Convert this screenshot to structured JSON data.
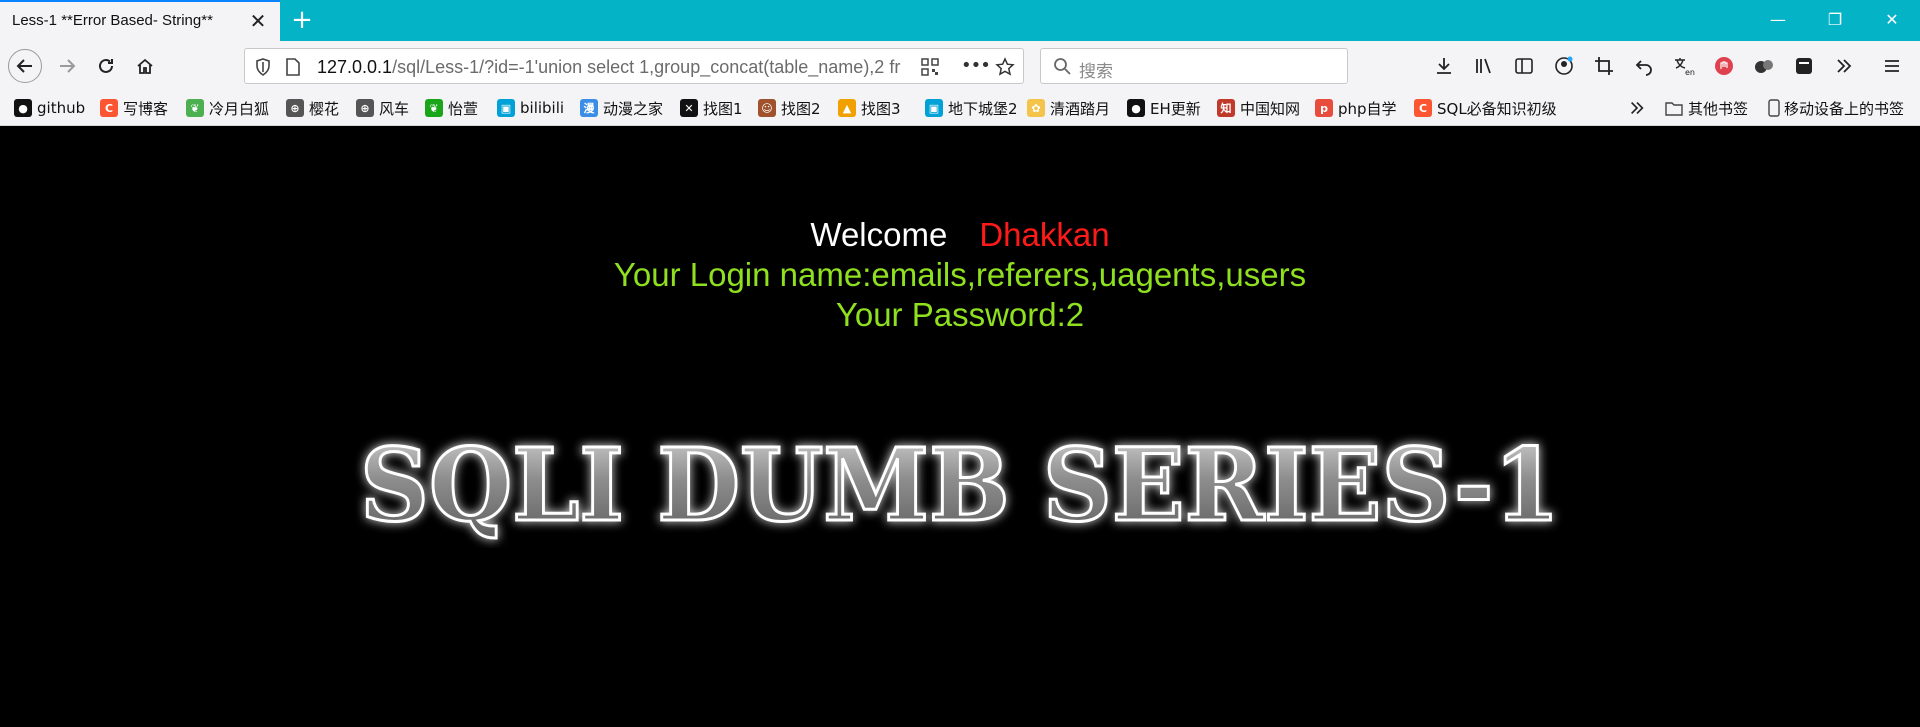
{
  "browser": {
    "tab_title": "Less-1 **Error Based- String**",
    "tab_close": "✕",
    "new_tab": "+",
    "window_controls": {
      "minimize": "—",
      "restore": "❐",
      "close": "✕"
    }
  },
  "toolbar": {
    "url_host": "127.0.0.1",
    "url_path": "/sql/Less-1/?id=-1'union select 1,group_concat(table_name),2 fr",
    "search_placeholder": "搜索",
    "overflow_label": "•••"
  },
  "bookmarks": [
    {
      "label": "github",
      "icon": "github-icon",
      "color": "#111111"
    },
    {
      "label": "写博客",
      "icon": "csdn-icon",
      "color": "#fc5531"
    },
    {
      "label": "冷月白狐",
      "icon": "leaf-icon",
      "color": "#4caf50"
    },
    {
      "label": "樱花",
      "icon": "globe-icon",
      "color": "#555555"
    },
    {
      "label": "风车",
      "icon": "globe-icon",
      "color": "#555555"
    },
    {
      "label": "怡萱",
      "icon": "leaf-icon",
      "color": "#1aa51a"
    },
    {
      "label": "bilibili",
      "icon": "bilibili-icon",
      "color": "#00a1d6"
    },
    {
      "label": "动漫之家",
      "icon": "dmzj-icon",
      "color": "#3a8ee6"
    },
    {
      "label": "找图1",
      "icon": "x-icon",
      "color": "#111111"
    },
    {
      "label": "找图2",
      "icon": "avatar-icon",
      "color": "#a0522d"
    },
    {
      "label": "找图3",
      "icon": "image-icon",
      "color": "#f0a000"
    },
    {
      "label": "地下城堡2",
      "icon": "bilibili-icon",
      "color": "#00a1d6"
    },
    {
      "label": "清酒踏月",
      "icon": "sun-icon",
      "color": "#f3c34a"
    },
    {
      "label": "EH更新",
      "icon": "github-icon",
      "color": "#111111"
    },
    {
      "label": "中国知网",
      "icon": "cnki-icon",
      "color": "#c0392b"
    },
    {
      "label": "php自学",
      "icon": "php-icon",
      "color": "#e74c3c"
    },
    {
      "label": "SQL必备知识初级",
      "icon": "csdn-icon",
      "color": "#fc5531"
    }
  ],
  "bookmarks_right": [
    {
      "label": "其他书签",
      "icon": "folder-icon"
    },
    {
      "label": "移动设备上的书签",
      "icon": "mobile-icon"
    }
  ],
  "page": {
    "welcome_label": "Welcome",
    "welcome_name": "Dhakkan",
    "login_line": "Your Login name:emails,referers,uagents,users",
    "password_line": "Your Password:2",
    "banner_text": "SQLI DUMB SERIES-1"
  },
  "colors": {
    "tabbar": "#05b3c7",
    "welcome_name": "#ff1a1a",
    "result_text": "#8fe01f"
  }
}
